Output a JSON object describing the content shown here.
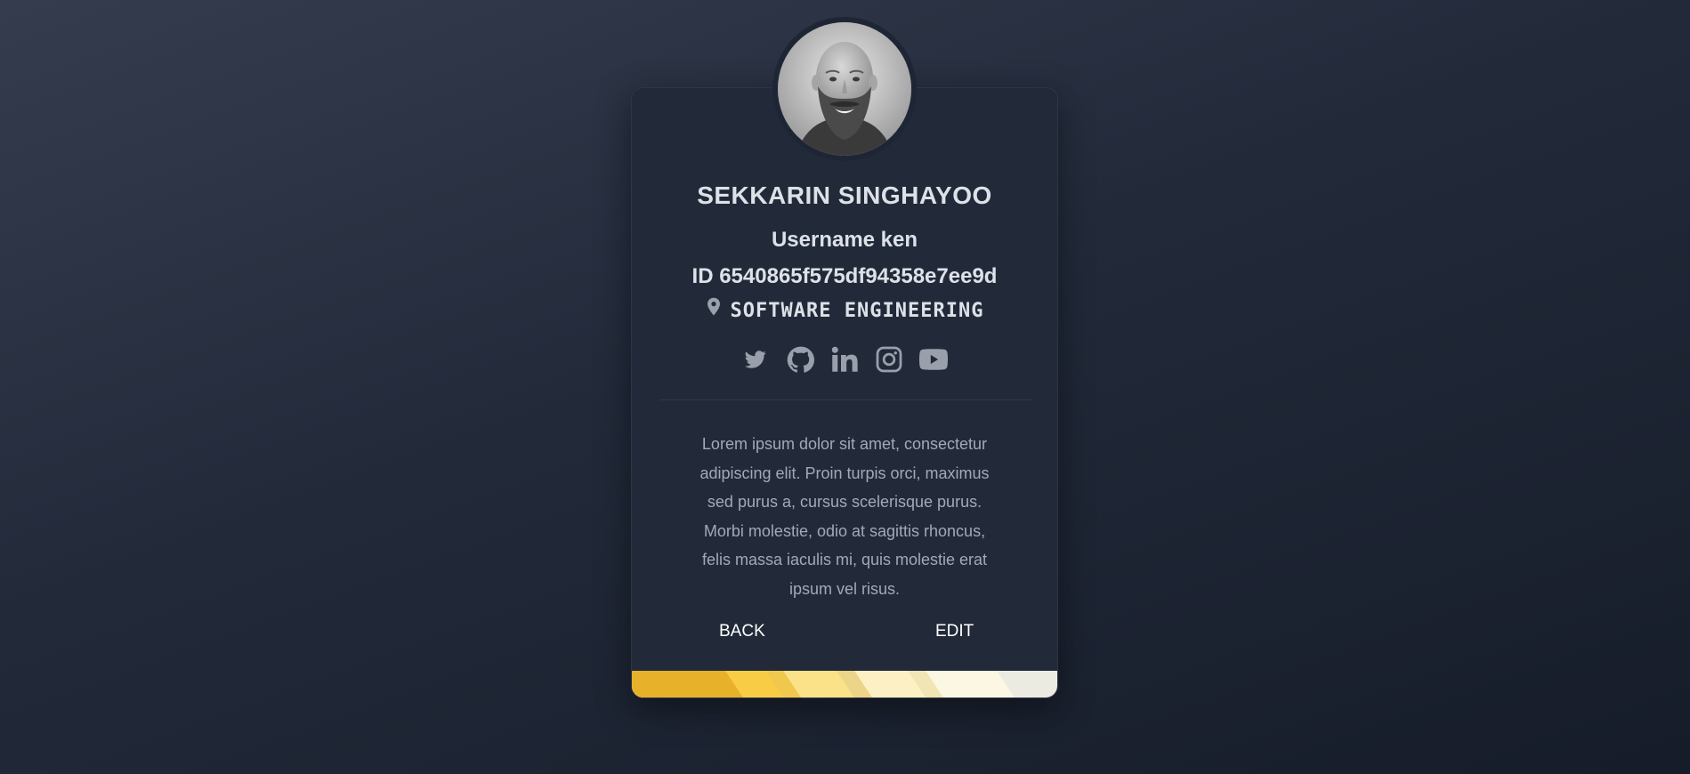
{
  "profile": {
    "name": "SEKKARIN SINGHAYOO",
    "username_line": "Username ken",
    "id_line": "ID 6540865f575df94358e7ee9d",
    "department": "SOFTWARE ENGINEERING",
    "location_icon": "map-pin-icon",
    "bio": "Lorem ipsum dolor sit amet, consectetur adipiscing elit. Proin turpis orci, maximus sed purus a, cursus scelerisque purus. Morbi molestie, odio at sagittis rhoncus, felis massa iaculis mi, quis molestie erat ipsum vel risus."
  },
  "socials": [
    {
      "icon": "twitter-icon"
    },
    {
      "icon": "github-icon"
    },
    {
      "icon": "linkedin-icon"
    },
    {
      "icon": "instagram-icon"
    },
    {
      "icon": "youtube-icon"
    }
  ],
  "actions": {
    "back_label": "BACK",
    "edit_label": "EDIT"
  },
  "colors": {
    "background": "#222a39",
    "text": "#dde1e8",
    "muted_text": "#a2a9b6",
    "icon": "#9aa0ab",
    "stripe": [
      "#e7b12a",
      "#f8cd45",
      "#fbe288",
      "#fdf0c4",
      "#fcf7e3",
      "#ecebe1"
    ]
  }
}
